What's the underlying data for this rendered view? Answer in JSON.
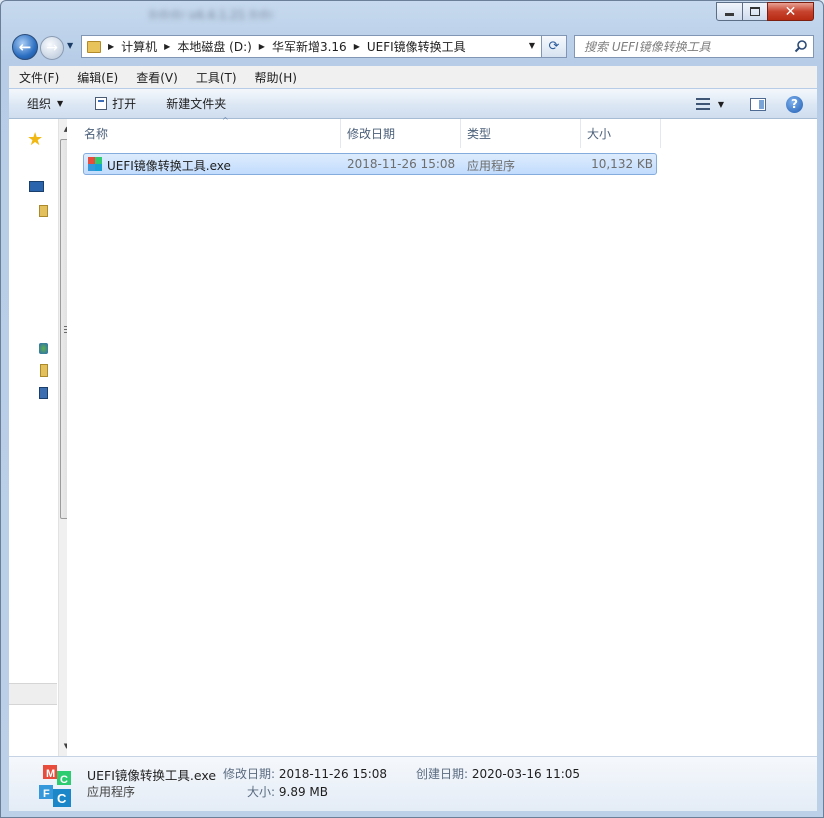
{
  "window": {
    "title": "ﾀｧﾀｧﾀｧ v4.4.1.21 ﾀｧﾀｧ"
  },
  "address": {
    "crumbs": [
      "计算机",
      "本地磁盘 (D:)",
      "华军新增3.16",
      "UEFI镜像转换工具"
    ]
  },
  "search": {
    "placeholder": "搜索 UEFI镜像转换工具"
  },
  "menu": {
    "items": [
      "文件(F)",
      "编辑(E)",
      "查看(V)",
      "工具(T)",
      "帮助(H)"
    ]
  },
  "toolbar": {
    "organize_label": "组织",
    "open_label": "打开",
    "new_folder_label": "新建文件夹"
  },
  "columns": {
    "name": "名称",
    "date_modified": "修改日期",
    "type": "类型",
    "size": "大小"
  },
  "files": [
    {
      "name": "UEFI镜像转换工具.exe",
      "date_modified": "2018-11-26 15:08",
      "type": "应用程序",
      "size": "10,132 KB"
    }
  ],
  "details": {
    "file_name": "UEFI镜像转换工具.exe",
    "file_type": "应用程序",
    "modified_label": "修改日期:",
    "modified_value": "2018-11-26 15:08",
    "created_label": "创建日期:",
    "created_value": "2020-03-16 11:05",
    "size_label": "大小:",
    "size_value": "9.89 MB"
  },
  "colors": {
    "selection_fill": "#cce4fd",
    "selection_border": "#84acdd",
    "column_header_text": "#4c607a"
  },
  "icons": {
    "back": "back-arrow-icon",
    "forward": "forward-arrow-icon",
    "refresh": "refresh-icon",
    "search": "search-icon",
    "view": "view-options-icon",
    "preview_pane": "preview-pane-icon",
    "help": "help-icon",
    "app": "mfc-application-icon"
  }
}
